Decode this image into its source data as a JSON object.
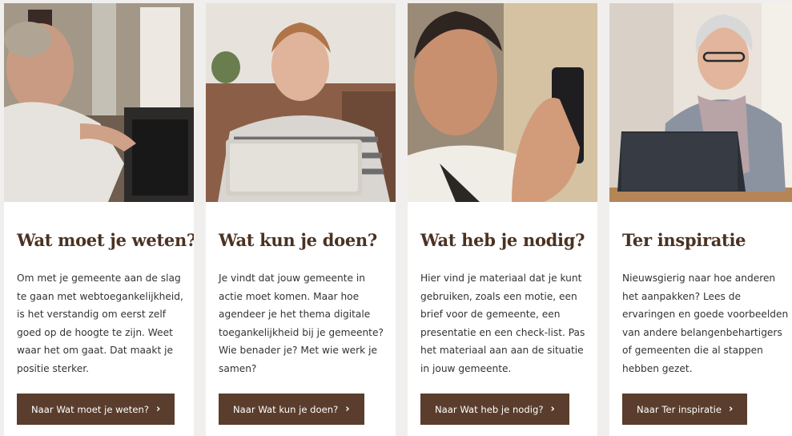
{
  "cards": [
    {
      "image_alt": "man-using-tablet",
      "title": "Wat moet je weten?",
      "body": "Om met je gemeente aan de slag te gaan met webtoegankelijkheid, is het verstandig om eerst zelf goed op de hoogte te zijn. Weet waar het om gaat. Dat maakt je positie sterker.",
      "button_label": "Naar Wat moet je weten?",
      "chevron": "›"
    },
    {
      "image_alt": "young-man-holding-tablet",
      "title": "Wat kun je doen?",
      "body": "Je vindt dat jouw gemeente in actie moet komen. Maar hoe agendeer je het thema digitale toegankelijkheid bij je gemeente? Wie benader je? Met wie werk je samen?",
      "button_label": "Naar Wat kun je doen?",
      "chevron": "›"
    },
    {
      "image_alt": "man-holding-phone",
      "title": "Wat heb je nodig?",
      "body": "Hier vind je materiaal dat je kunt gebruiken, zoals een motie, een brief voor de gemeente, een presentatie en een check-list. Pas het materiaal aan aan de situatie in jouw gemeente.",
      "button_label": "Naar Wat heb je nodig?",
      "chevron": "›"
    },
    {
      "image_alt": "older-woman-with-laptop",
      "title": "Ter inspiratie",
      "body": "Nieuwsgierig naar hoe anderen het aanpakken? Lees de ervaringen en goede voorbeelden van andere belangenbehartigers of gemeenten die al stappen hebben gezet.",
      "button_label": "Naar Ter inspiratie",
      "chevron": "›"
    }
  ],
  "colors": {
    "title": "#4a3222",
    "button_bg": "#5a3d2c",
    "page_bg": "#f1efed"
  }
}
